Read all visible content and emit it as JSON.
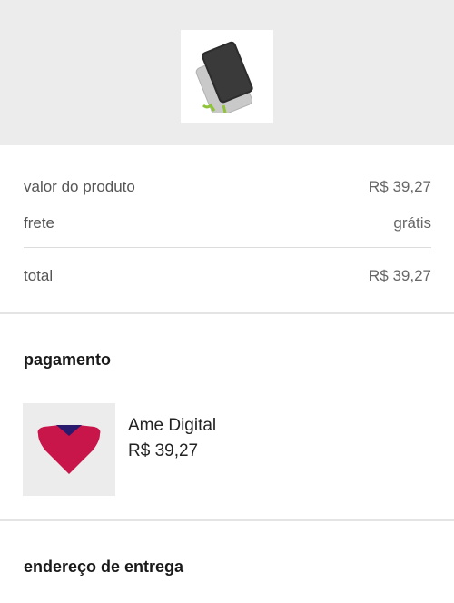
{
  "product": {
    "image_icon": "power-bank-icon"
  },
  "summary": {
    "product_value_label": "valor do produto",
    "product_value": "R$ 39,27",
    "shipping_label": "frete",
    "shipping_value": "grátis",
    "total_label": "total",
    "total_value": "R$ 39,27"
  },
  "payment": {
    "section_title": "pagamento",
    "method_name": "Ame Digital",
    "amount": "R$ 39,27",
    "logo_icon": "ame-digital-heart-icon",
    "logo_colors": {
      "heart": "#c8154a",
      "top": "#2a1a6e"
    }
  },
  "address": {
    "section_title": "endereço de entrega"
  }
}
